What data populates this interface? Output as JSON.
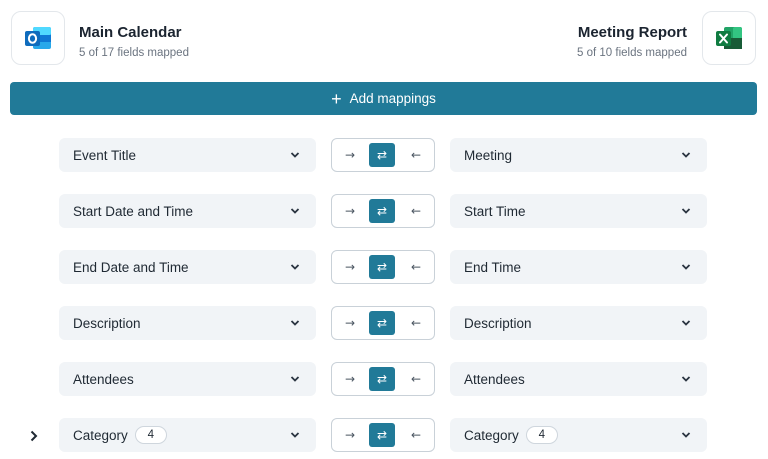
{
  "source": {
    "title": "Main Calendar",
    "subtitle": "5 of 17 fields mapped",
    "icon": "outlook-icon",
    "color": "#0f6cbd"
  },
  "destination": {
    "title": "Meeting Report",
    "subtitle": "5 of 10 fields mapped",
    "icon": "excel-icon",
    "color": "#107c41"
  },
  "add_button": {
    "icon": "plus-icon",
    "label": "Add mappings",
    "color": "#217a98"
  },
  "direction_icons": {
    "to_right": "→",
    "both": "⇄",
    "to_left": "←"
  },
  "mappings": [
    {
      "source": "Event Title",
      "destination": "Meeting",
      "direction": "both"
    },
    {
      "source": "Start Date and Time",
      "destination": "Start Time",
      "direction": "both"
    },
    {
      "source": "End Date and Time",
      "destination": "End Time",
      "direction": "both"
    },
    {
      "source": "Description",
      "destination": "Description",
      "direction": "both"
    },
    {
      "source": "Attendees",
      "destination": "Attendees",
      "direction": "both"
    },
    {
      "source": "Category",
      "source_badge": "4",
      "destination": "Category",
      "destination_badge": "4",
      "direction": "both",
      "expandable": true
    }
  ]
}
